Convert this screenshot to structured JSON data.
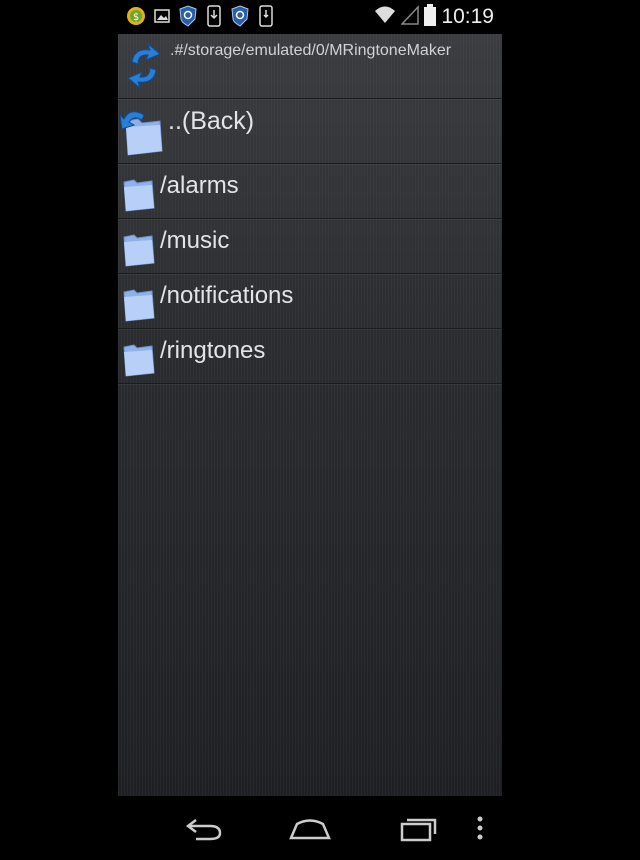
{
  "status_bar": {
    "time": "10:19",
    "icons_left": [
      "cash-icon",
      "image-icon",
      "shield-icon",
      "download-icon",
      "shield-icon",
      "phone-download-icon"
    ],
    "icons_right": [
      "wifi-icon",
      "signal-icon",
      "battery-icon"
    ]
  },
  "browser": {
    "path": ".#/storage/emulated/0/MRingtoneMaker",
    "back_label": "..(Back)",
    "folders": [
      {
        "name": "/alarms"
      },
      {
        "name": "/music"
      },
      {
        "name": "/notifications"
      },
      {
        "name": "/ringtones"
      }
    ]
  },
  "nav_bar": {
    "buttons": [
      "back-nav-icon",
      "home-icon",
      "recents-icon",
      "overflow-menu-icon"
    ]
  },
  "colors": {
    "background": "#2a2c30",
    "folder_blue": "#a9c4f5",
    "accent_blue": "#2a7fd4"
  }
}
